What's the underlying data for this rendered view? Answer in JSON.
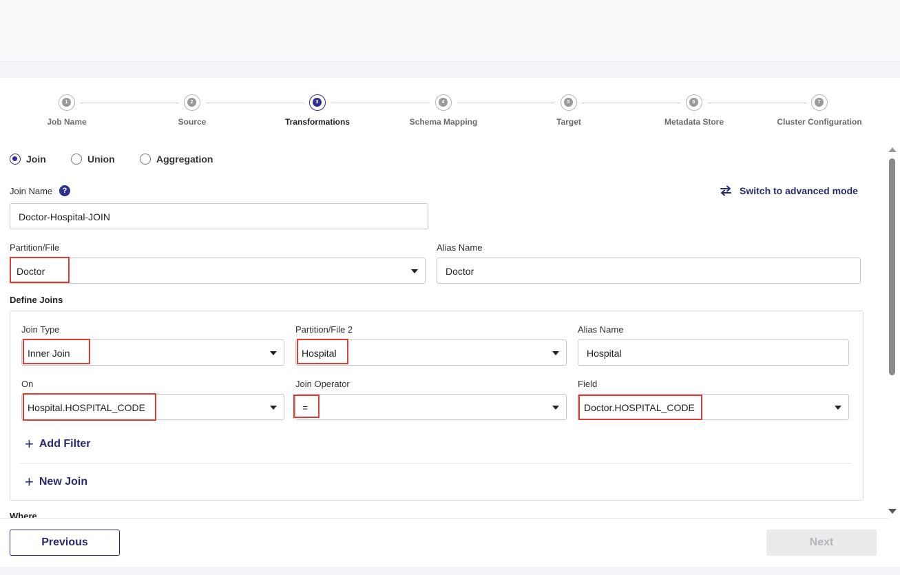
{
  "steps": [
    {
      "num": "1",
      "label": "Job Name"
    },
    {
      "num": "2",
      "label": "Source"
    },
    {
      "num": "3",
      "label": "Transformations"
    },
    {
      "num": "4",
      "label": "Schema Mapping"
    },
    {
      "num": "5",
      "label": "Target"
    },
    {
      "num": "6",
      "label": "Metadata Store"
    },
    {
      "num": "7",
      "label": "Cluster Configuration"
    }
  ],
  "active_step": "3",
  "transform_types": {
    "join": "Join",
    "union": "Union",
    "aggregation": "Aggregation",
    "selected": "Join"
  },
  "join_name": {
    "label": "Join Name",
    "help": "?",
    "value": "Doctor-Hospital-JOIN"
  },
  "advanced_mode": "Switch to advanced mode",
  "partition": {
    "label": "Partition/File",
    "value": "Doctor",
    "alias_label": "Alias Name",
    "alias_value": "Doctor"
  },
  "define_joins": {
    "title": "Define Joins",
    "join_type_label": "Join Type",
    "join_type_value": "Inner Join",
    "partition2_label": "Partition/File 2",
    "partition2_value": "Hospital",
    "alias2_label": "Alias Name",
    "alias2_value": "Hospital",
    "on_label": "On",
    "on_value": "Hospital.HOSPITAL_CODE",
    "operator_label": "Join Operator",
    "operator_value": "=",
    "field_label": "Field",
    "field_value": "Doctor.HOSPITAL_CODE",
    "add_filter": "Add Filter",
    "new_join": "New Join"
  },
  "where_label": "Where",
  "footer": {
    "previous": "Previous",
    "next": "Next"
  },
  "colors": {
    "accent": "#2f2f8f",
    "link": "#2a2a6e",
    "highlight": "#e53935"
  }
}
